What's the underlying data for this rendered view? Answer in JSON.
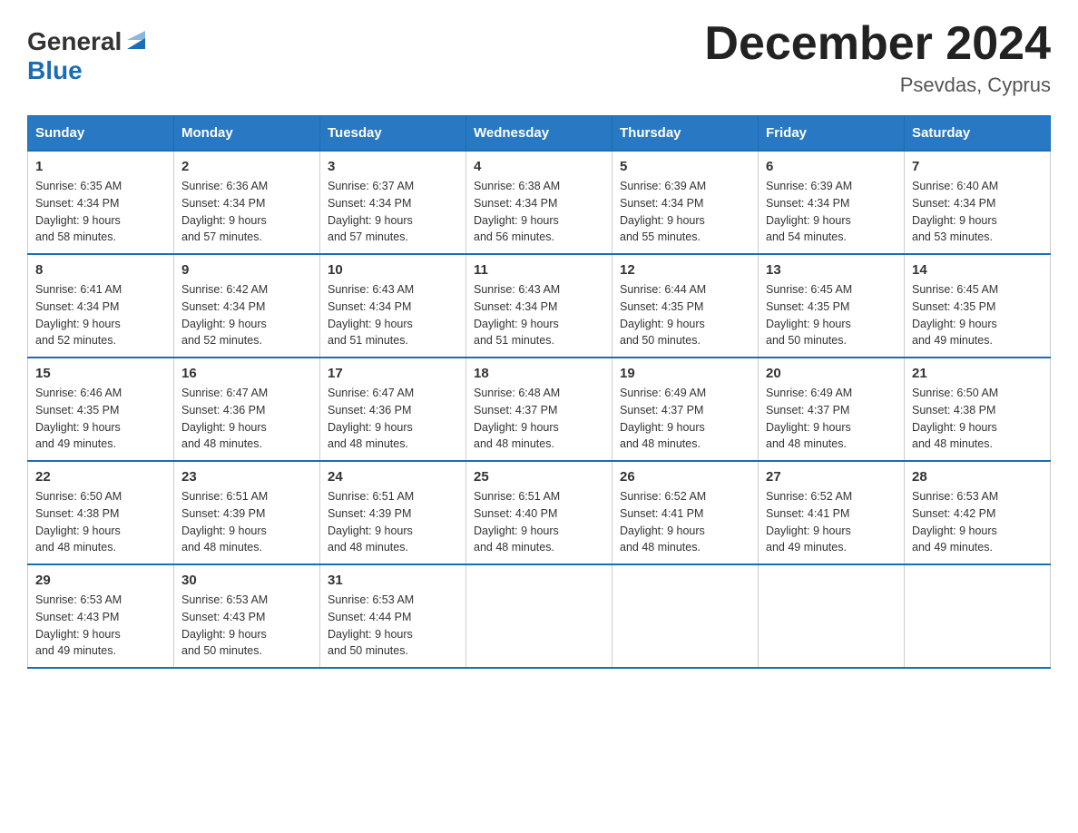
{
  "logo": {
    "text_general": "General",
    "text_blue": "Blue",
    "arrow": "▶"
  },
  "title": "December 2024",
  "subtitle": "Psevdas, Cyprus",
  "headers": [
    "Sunday",
    "Monday",
    "Tuesday",
    "Wednesday",
    "Thursday",
    "Friday",
    "Saturday"
  ],
  "weeks": [
    [
      {
        "day": "1",
        "sunrise": "6:35 AM",
        "sunset": "4:34 PM",
        "daylight": "9 hours and 58 minutes."
      },
      {
        "day": "2",
        "sunrise": "6:36 AM",
        "sunset": "4:34 PM",
        "daylight": "9 hours and 57 minutes."
      },
      {
        "day": "3",
        "sunrise": "6:37 AM",
        "sunset": "4:34 PM",
        "daylight": "9 hours and 57 minutes."
      },
      {
        "day": "4",
        "sunrise": "6:38 AM",
        "sunset": "4:34 PM",
        "daylight": "9 hours and 56 minutes."
      },
      {
        "day": "5",
        "sunrise": "6:39 AM",
        "sunset": "4:34 PM",
        "daylight": "9 hours and 55 minutes."
      },
      {
        "day": "6",
        "sunrise": "6:39 AM",
        "sunset": "4:34 PM",
        "daylight": "9 hours and 54 minutes."
      },
      {
        "day": "7",
        "sunrise": "6:40 AM",
        "sunset": "4:34 PM",
        "daylight": "9 hours and 53 minutes."
      }
    ],
    [
      {
        "day": "8",
        "sunrise": "6:41 AM",
        "sunset": "4:34 PM",
        "daylight": "9 hours and 52 minutes."
      },
      {
        "day": "9",
        "sunrise": "6:42 AM",
        "sunset": "4:34 PM",
        "daylight": "9 hours and 52 minutes."
      },
      {
        "day": "10",
        "sunrise": "6:43 AM",
        "sunset": "4:34 PM",
        "daylight": "9 hours and 51 minutes."
      },
      {
        "day": "11",
        "sunrise": "6:43 AM",
        "sunset": "4:34 PM",
        "daylight": "9 hours and 51 minutes."
      },
      {
        "day": "12",
        "sunrise": "6:44 AM",
        "sunset": "4:35 PM",
        "daylight": "9 hours and 50 minutes."
      },
      {
        "day": "13",
        "sunrise": "6:45 AM",
        "sunset": "4:35 PM",
        "daylight": "9 hours and 50 minutes."
      },
      {
        "day": "14",
        "sunrise": "6:45 AM",
        "sunset": "4:35 PM",
        "daylight": "9 hours and 49 minutes."
      }
    ],
    [
      {
        "day": "15",
        "sunrise": "6:46 AM",
        "sunset": "4:35 PM",
        "daylight": "9 hours and 49 minutes."
      },
      {
        "day": "16",
        "sunrise": "6:47 AM",
        "sunset": "4:36 PM",
        "daylight": "9 hours and 48 minutes."
      },
      {
        "day": "17",
        "sunrise": "6:47 AM",
        "sunset": "4:36 PM",
        "daylight": "9 hours and 48 minutes."
      },
      {
        "day": "18",
        "sunrise": "6:48 AM",
        "sunset": "4:37 PM",
        "daylight": "9 hours and 48 minutes."
      },
      {
        "day": "19",
        "sunrise": "6:49 AM",
        "sunset": "4:37 PM",
        "daylight": "9 hours and 48 minutes."
      },
      {
        "day": "20",
        "sunrise": "6:49 AM",
        "sunset": "4:37 PM",
        "daylight": "9 hours and 48 minutes."
      },
      {
        "day": "21",
        "sunrise": "6:50 AM",
        "sunset": "4:38 PM",
        "daylight": "9 hours and 48 minutes."
      }
    ],
    [
      {
        "day": "22",
        "sunrise": "6:50 AM",
        "sunset": "4:38 PM",
        "daylight": "9 hours and 48 minutes."
      },
      {
        "day": "23",
        "sunrise": "6:51 AM",
        "sunset": "4:39 PM",
        "daylight": "9 hours and 48 minutes."
      },
      {
        "day": "24",
        "sunrise": "6:51 AM",
        "sunset": "4:39 PM",
        "daylight": "9 hours and 48 minutes."
      },
      {
        "day": "25",
        "sunrise": "6:51 AM",
        "sunset": "4:40 PM",
        "daylight": "9 hours and 48 minutes."
      },
      {
        "day": "26",
        "sunrise": "6:52 AM",
        "sunset": "4:41 PM",
        "daylight": "9 hours and 48 minutes."
      },
      {
        "day": "27",
        "sunrise": "6:52 AM",
        "sunset": "4:41 PM",
        "daylight": "9 hours and 49 minutes."
      },
      {
        "day": "28",
        "sunrise": "6:53 AM",
        "sunset": "4:42 PM",
        "daylight": "9 hours and 49 minutes."
      }
    ],
    [
      {
        "day": "29",
        "sunrise": "6:53 AM",
        "sunset": "4:43 PM",
        "daylight": "9 hours and 49 minutes."
      },
      {
        "day": "30",
        "sunrise": "6:53 AM",
        "sunset": "4:43 PM",
        "daylight": "9 hours and 50 minutes."
      },
      {
        "day": "31",
        "sunrise": "6:53 AM",
        "sunset": "4:44 PM",
        "daylight": "9 hours and 50 minutes."
      },
      null,
      null,
      null,
      null
    ]
  ],
  "labels": {
    "sunrise": "Sunrise:",
    "sunset": "Sunset:",
    "daylight": "Daylight:"
  }
}
